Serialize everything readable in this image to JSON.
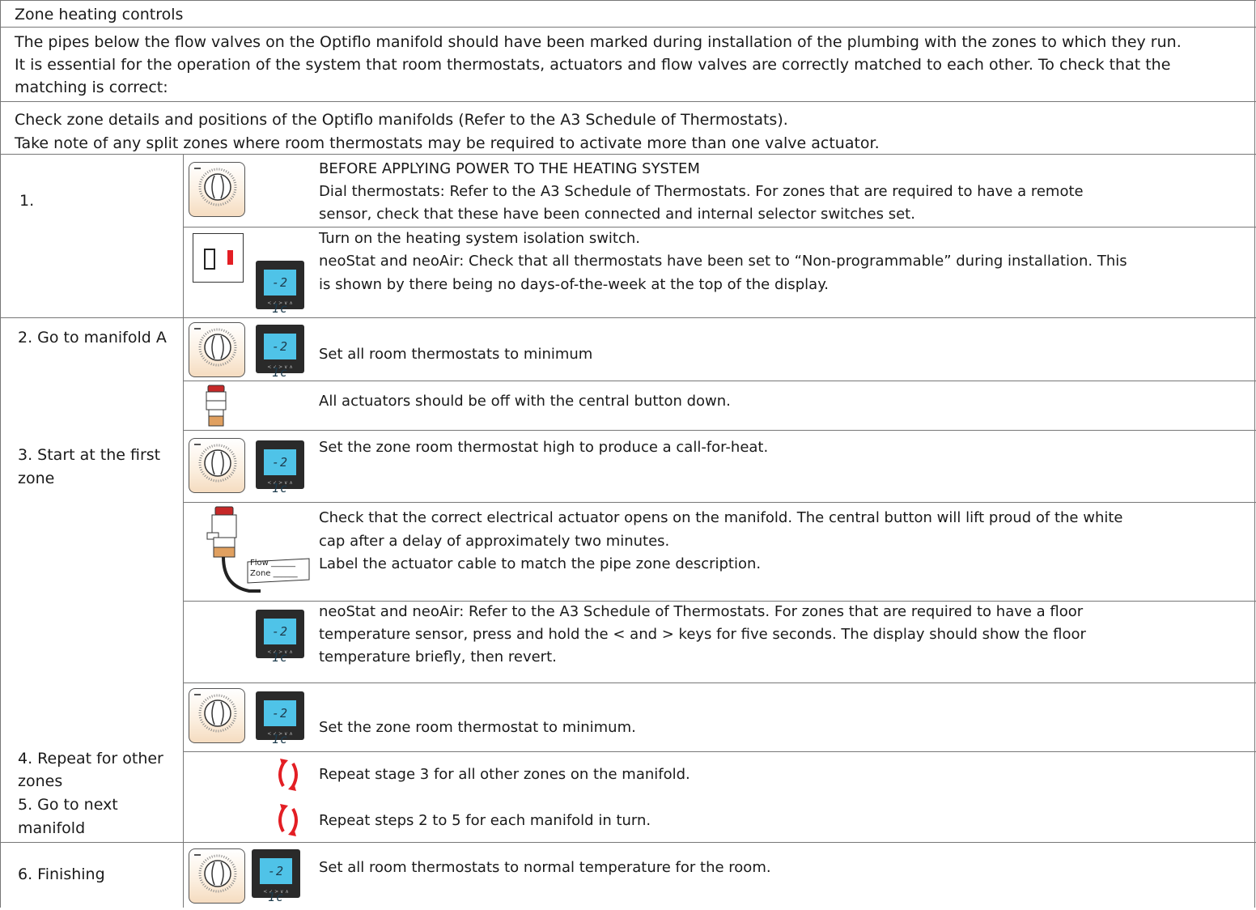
{
  "title": "Zone heating controls",
  "intro": [
    "The pipes below the flow valves on the Optiflo manifold should have been marked during installation of the plumbing with the zones to which they run.",
    "It is essential for the operation of the system that room thermostats, actuators and flow valves are correctly matched to each other. To check that the",
    "matching is correct:"
  ],
  "check": [
    "Check zone details and positions of the Optiflo manifolds (Refer to the A3 Schedule of Thermostats).",
    "Take note of any split zones where room thermostats may be required to activate more than one valve actuator."
  ],
  "steps": {
    "s1": "1.",
    "s2": "2. Go to manifold A",
    "s3a": "3. Start at the first",
    "s3b": "zone",
    "s4a": "4. Repeat for other",
    "s4b": "zones",
    "s5a": "5. Go to next",
    "s5b": "manifold",
    "s6": "6. Finishing"
  },
  "rows": {
    "r1a": "BEFORE APPLYING POWER TO THE HEATING SYSTEM",
    "r1b": "Dial thermostats: Refer to the A3 Schedule of Thermostats.  For zones that are required to have a remote",
    "r1c": "sensor, check that these have been connected and internal selector switches set.",
    "r2a": "Turn on the heating system isolation switch.",
    "r2b": "neoStat and neoAir:  Check that all thermostats have been set to “Non-programmable” during installation.  This",
    "r2c": "is shown by there being no days-of-the-week at the top of the display.",
    "r3": "Set all room thermostats to minimum",
    "r4": "All actuators should be off with the central button down.",
    "r5": "Set the zone room thermostat high to produce a call-for-heat.",
    "r6a": "Check that the correct electrical actuator opens on the manifold. The central button will lift proud of the white",
    "r6b": "cap after a delay of approximately two minutes.",
    "r6c": "Label the actuator cable to match the pipe zone description.",
    "r7a": "neoStat and neoAir: Refer to the A3 Schedule of Thermostats.  For zones that are required to have a floor",
    "r7b": "temperature sensor, press and hold the < and > keys for five seconds.  The display should show the floor",
    "r7c": "temperature briefly, then revert.",
    "r8": "Set the zone room thermostat to minimum.",
    "r9": "Repeat stage 3 for all other zones on the manifold.",
    "r10": "Repeat steps 2 to 5 for each manifold in turn.",
    "r11": "Set all room thermostats to normal temperature for the room."
  },
  "label_tag": {
    "flow": "Flow ______",
    "zone": "Zone ______"
  },
  "display_digits": "-2 1c",
  "icons": [
    "dial-thermostat-icon",
    "neostat-icon",
    "isolation-switch-icon",
    "actuator-icon",
    "repeat-arrows-icon"
  ]
}
